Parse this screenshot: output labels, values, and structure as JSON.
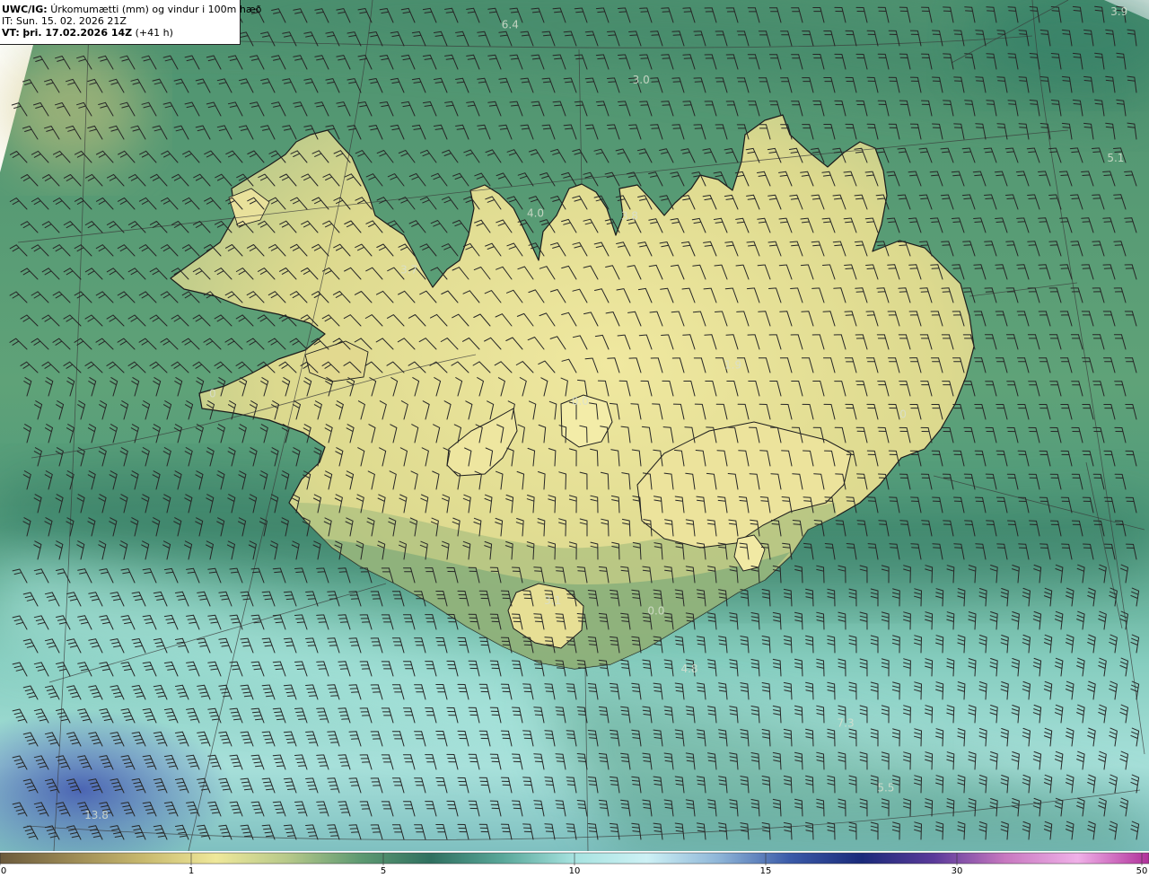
{
  "header": {
    "model": "UWC/IG:",
    "title": "Úrkomumætti (mm) og vindur i 100m hæð",
    "it_label": "IT:",
    "it_value": "Sun. 15. 02. 2026 21Z",
    "vt_label": "VT:",
    "vt_value": "þri. 17.02.2026 14Z",
    "vt_lead": "(+41 h)"
  },
  "map_labels": [
    {
      "text": "6.4",
      "lon": 0.444,
      "lat": 0.033
    },
    {
      "text": "3.0",
      "lon": 0.558,
      "lat": 0.098
    },
    {
      "text": "3.9",
      "lon": 0.974,
      "lat": 0.018
    },
    {
      "text": "5.1",
      "lon": 0.971,
      "lat": 0.19
    },
    {
      "text": "4.0",
      "lon": 0.466,
      "lat": 0.255
    },
    {
      "text": "3.8",
      "lon": 0.548,
      "lat": 0.258
    },
    {
      "text": "3.7",
      "lon": 0.356,
      "lat": 0.321
    },
    {
      "text": "1.9",
      "lon": 0.638,
      "lat": 0.433
    },
    {
      "text": "0.0",
      "lon": 0.505,
      "lat": 0.476
    },
    {
      "text": "0",
      "lon": 0.185,
      "lat": 0.467
    },
    {
      "text": "0",
      "lon": 0.786,
      "lat": 0.491
    },
    {
      "text": "3.1",
      "lon": 0.481,
      "lat": 0.71
    },
    {
      "text": "0.0",
      "lon": 0.571,
      "lat": 0.722
    },
    {
      "text": "4.8",
      "lon": 0.6,
      "lat": 0.79
    },
    {
      "text": "7.3",
      "lon": 0.736,
      "lat": 0.854
    },
    {
      "text": "5.5",
      "lon": 0.771,
      "lat": 0.93
    },
    {
      "text": "13.8",
      "lon": 0.084,
      "lat": 0.962
    }
  ],
  "colorbar": {
    "ticks": [
      "0",
      "1",
      "5",
      "10",
      "15",
      "30",
      "50"
    ],
    "colors": [
      "#6b5a3c",
      "#9c8a55",
      "#c8b96e",
      "#efe89a",
      "#b7c98a",
      "#5e9a72",
      "#2f7060",
      "#5aa89a",
      "#a7e3e0",
      "#cdf1f5",
      "#8fb6d8",
      "#3a5aa8",
      "#1a2a7a",
      "#5b3a9a",
      "#c878c0",
      "#f0b0e8",
      "#b0309a"
    ]
  },
  "colors": {
    "land": "#e3dd93",
    "sea_near": "#4f9a75",
    "sea_far": "#2f7a68",
    "band_light": "#8fd3c4",
    "band_cyan": "#b6eded",
    "deep_blue": "#4d63b5",
    "coast": "#1c1c1c",
    "barb": "#2a2a2a",
    "grid": "#444444"
  },
  "icons": [
    "wind-barb-icon"
  ]
}
